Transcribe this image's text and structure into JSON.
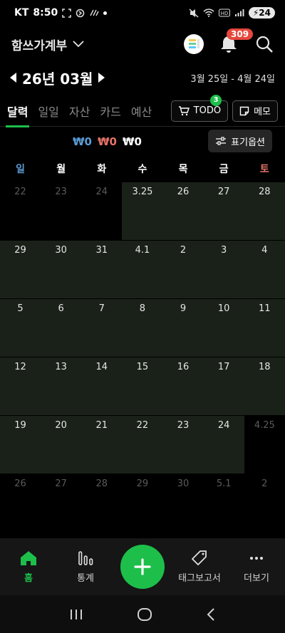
{
  "status_bar": {
    "carrier": "KT",
    "time": "8:50",
    "battery": "24"
  },
  "header": {
    "book_title": "함쓰가계부",
    "notification_count": "309"
  },
  "month": {
    "label": "26년 03월",
    "period": "3월 25일 - 4월 24일"
  },
  "tabs": [
    "달력",
    "일일",
    "자산",
    "카드",
    "예산"
  ],
  "tab_buttons": {
    "todo_label": "TODO",
    "todo_count": "3",
    "memo_label": "메모"
  },
  "totals": {
    "income": "₩0",
    "expense": "₩0",
    "balance": "₩0",
    "options_label": "표기옵션"
  },
  "weekdays": [
    "일",
    "월",
    "화",
    "수",
    "목",
    "금",
    "토"
  ],
  "weeks": [
    [
      "22",
      "23",
      "24",
      "3.25",
      "26",
      "27",
      "28"
    ],
    [
      "29",
      "30",
      "31",
      "4.1",
      "2",
      "3",
      "4"
    ],
    [
      "5",
      "6",
      "7",
      "8",
      "9",
      "10",
      "11"
    ],
    [
      "12",
      "13",
      "14",
      "15",
      "16",
      "17",
      "18"
    ],
    [
      "19",
      "20",
      "21",
      "22",
      "23",
      "24",
      "4.25"
    ],
    [
      "26",
      "27",
      "28",
      "29",
      "30",
      "5.1",
      "2"
    ]
  ],
  "bottom_nav": {
    "home": "홈",
    "stats": "통계",
    "tag_report": "태그보고서",
    "more": "더보기"
  },
  "colors": {
    "accent": "#1dbf4a",
    "income": "#5b9bd5",
    "expense": "#e57368",
    "period_bg": "#1a2119"
  }
}
